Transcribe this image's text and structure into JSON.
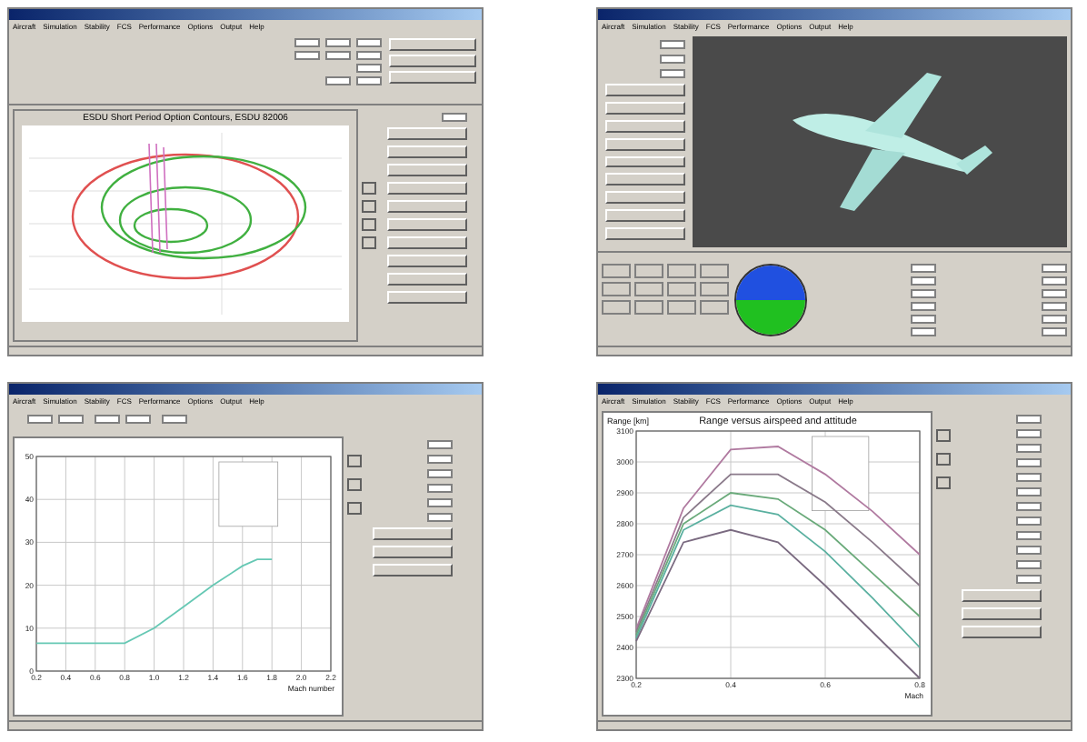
{
  "windows": [
    {
      "kind": "contours",
      "menu": [
        "Aircraft",
        "Simulation",
        "Stability",
        "FCS",
        "Performance",
        "Options",
        "Output",
        "Help"
      ],
      "chart_title": "ESDU Short Period Option Contours, ESDU 82006"
    },
    {
      "kind": "simulation",
      "menu": [
        "Aircraft",
        "Simulation",
        "Stability",
        "FCS",
        "Performance",
        "Options",
        "Output",
        "Help"
      ]
    },
    {
      "kind": "line",
      "menu": [
        "Aircraft",
        "Simulation",
        "Stability",
        "FCS",
        "Performance",
        "Options",
        "Output",
        "Help"
      ],
      "chart_data": {
        "type": "line",
        "xlabel": "Mach number",
        "x": [
          0.2,
          0.4,
          0.6,
          0.8,
          1.0,
          1.2,
          1.4,
          1.6,
          1.7,
          1.8
        ],
        "series": [
          {
            "color": "#66c8b4",
            "values": [
              6.5,
              6.5,
              6.5,
              6.5,
              10,
              15,
              20,
              24.5,
              26,
              26
            ]
          }
        ],
        "grid": true,
        "xlim": [
          0.2,
          2.2
        ],
        "ylim": [
          0,
          50
        ],
        "xticks": [
          0.2,
          0.4,
          0.6,
          0.8,
          {
            "value": 1.0,
            "label": "1.0"
          },
          1.2,
          1.4,
          1.6,
          1.8,
          {
            "value": 2.0,
            "label": "2.0"
          },
          2.2
        ],
        "yticks": [
          0,
          10,
          20,
          30,
          40,
          50
        ]
      }
    },
    {
      "kind": "range",
      "menu": [
        "Aircraft",
        "Simulation",
        "Stability",
        "FCS",
        "Performance",
        "Options",
        "Output",
        "Help"
      ],
      "chart_data": {
        "type": "line",
        "title": "Range versus airspeed and attitude",
        "xlabel": "Mach",
        "ylabel": "Range [km]",
        "x": [
          0.2,
          0.3,
          0.4,
          0.5,
          0.6,
          0.7,
          0.8
        ],
        "series": [
          {
            "color": "#b07aa0",
            "values": [
              2460,
              2850,
              3040,
              3050,
              2960,
              2840,
              2700
            ]
          },
          {
            "color": "#8a7a8a",
            "values": [
              2450,
              2820,
              2960,
              2960,
              2870,
              2740,
              2600
            ]
          },
          {
            "color": "#6aaa7a",
            "values": [
              2440,
              2800,
              2900,
              2880,
              2780,
              2640,
              2500
            ]
          },
          {
            "color": "#5ab0a0",
            "values": [
              2430,
              2780,
              2860,
              2830,
              2710,
              2560,
              2400
            ]
          },
          {
            "color": "#7a6a80",
            "values": [
              2420,
              2740,
              2780,
              2740,
              2600,
              2450,
              2300
            ]
          }
        ],
        "grid": true,
        "xlim": [
          0.2,
          0.8
        ],
        "ylim": [
          2300,
          3100
        ],
        "xticks": [
          0.2,
          0.4,
          0.6,
          0.8
        ],
        "yticks": [
          2300,
          2400,
          2500,
          2600,
          2700,
          2800,
          2900,
          3000,
          3100
        ]
      }
    }
  ]
}
